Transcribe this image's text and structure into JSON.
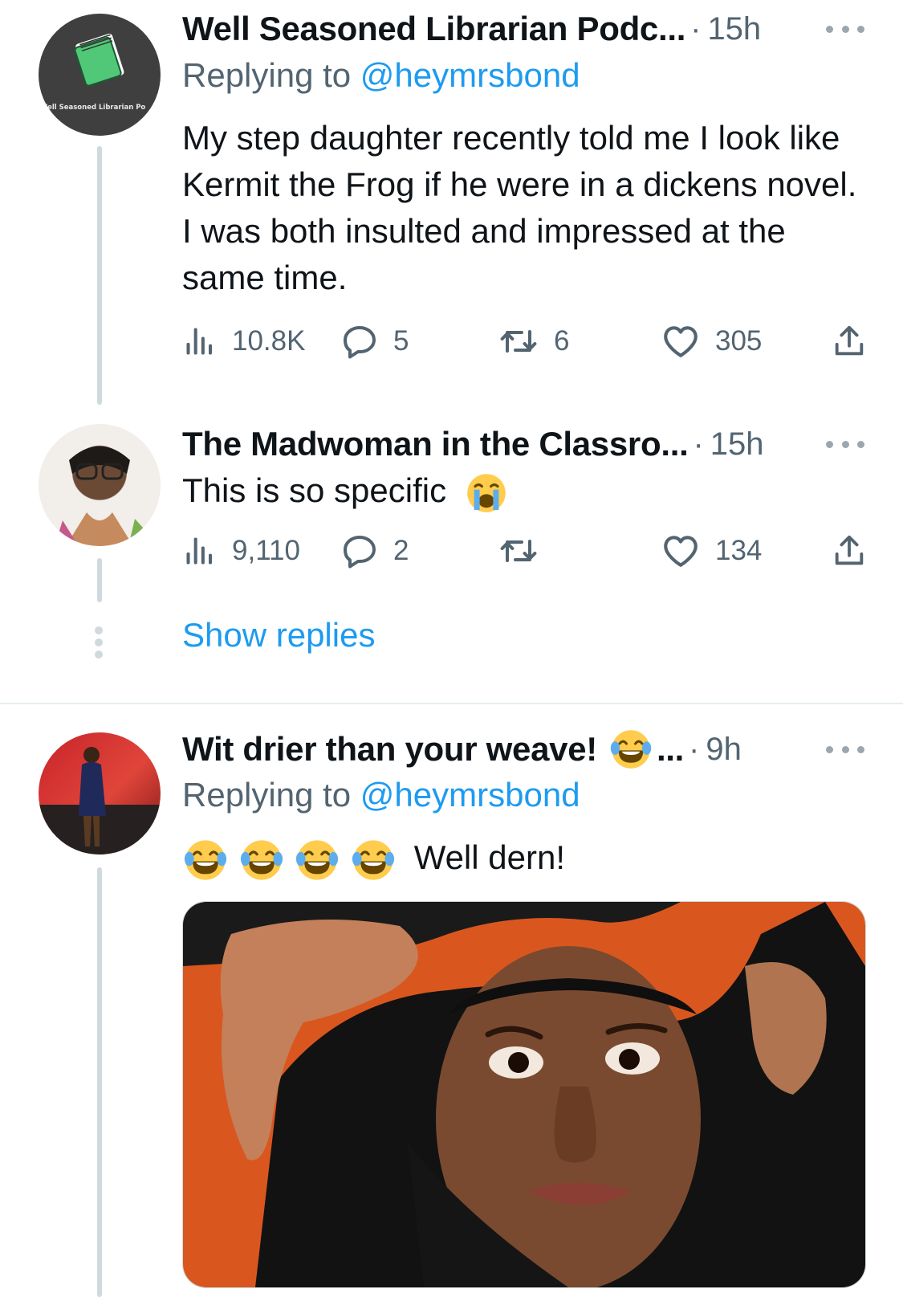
{
  "tweets": [
    {
      "display_name": "Well Seasoned Librarian Podc...",
      "separator": "·",
      "time": "15h",
      "reply_prefix": "Replying to",
      "reply_handle": "@heymrsbond",
      "text": "My step daughter recently told me I look like Kermit the Frog if he were in a dickens novel. I was both insulted and impressed at the same time.",
      "avatar_label": "Well Seasoned Librarian Po",
      "views": "10.8K",
      "replies": "5",
      "retweets": "6",
      "likes": "305"
    },
    {
      "display_name": "The Madwoman in the Classro...",
      "separator": "·",
      "time": "15h",
      "text": "This is so specific",
      "views": "9,110",
      "replies": "2",
      "retweets": "",
      "likes": "134"
    },
    {
      "display_name": "Wit drier than your weave!",
      "name_suffix": "...",
      "separator": "·",
      "time": "9h",
      "reply_prefix": "Replying to",
      "reply_handle": "@heymrsbond",
      "text": "Well dern!"
    }
  ],
  "show_replies": "Show replies",
  "colors": {
    "accent": "#1d9bf0",
    "secondary_text": "#536471",
    "thread_line": "#cfd9de"
  },
  "icons": [
    "more-icon",
    "views-icon",
    "reply-icon",
    "retweet-icon",
    "like-icon",
    "share-icon",
    "crying-emoji-icon",
    "laughing-emoji-icon",
    "book-icon"
  ]
}
